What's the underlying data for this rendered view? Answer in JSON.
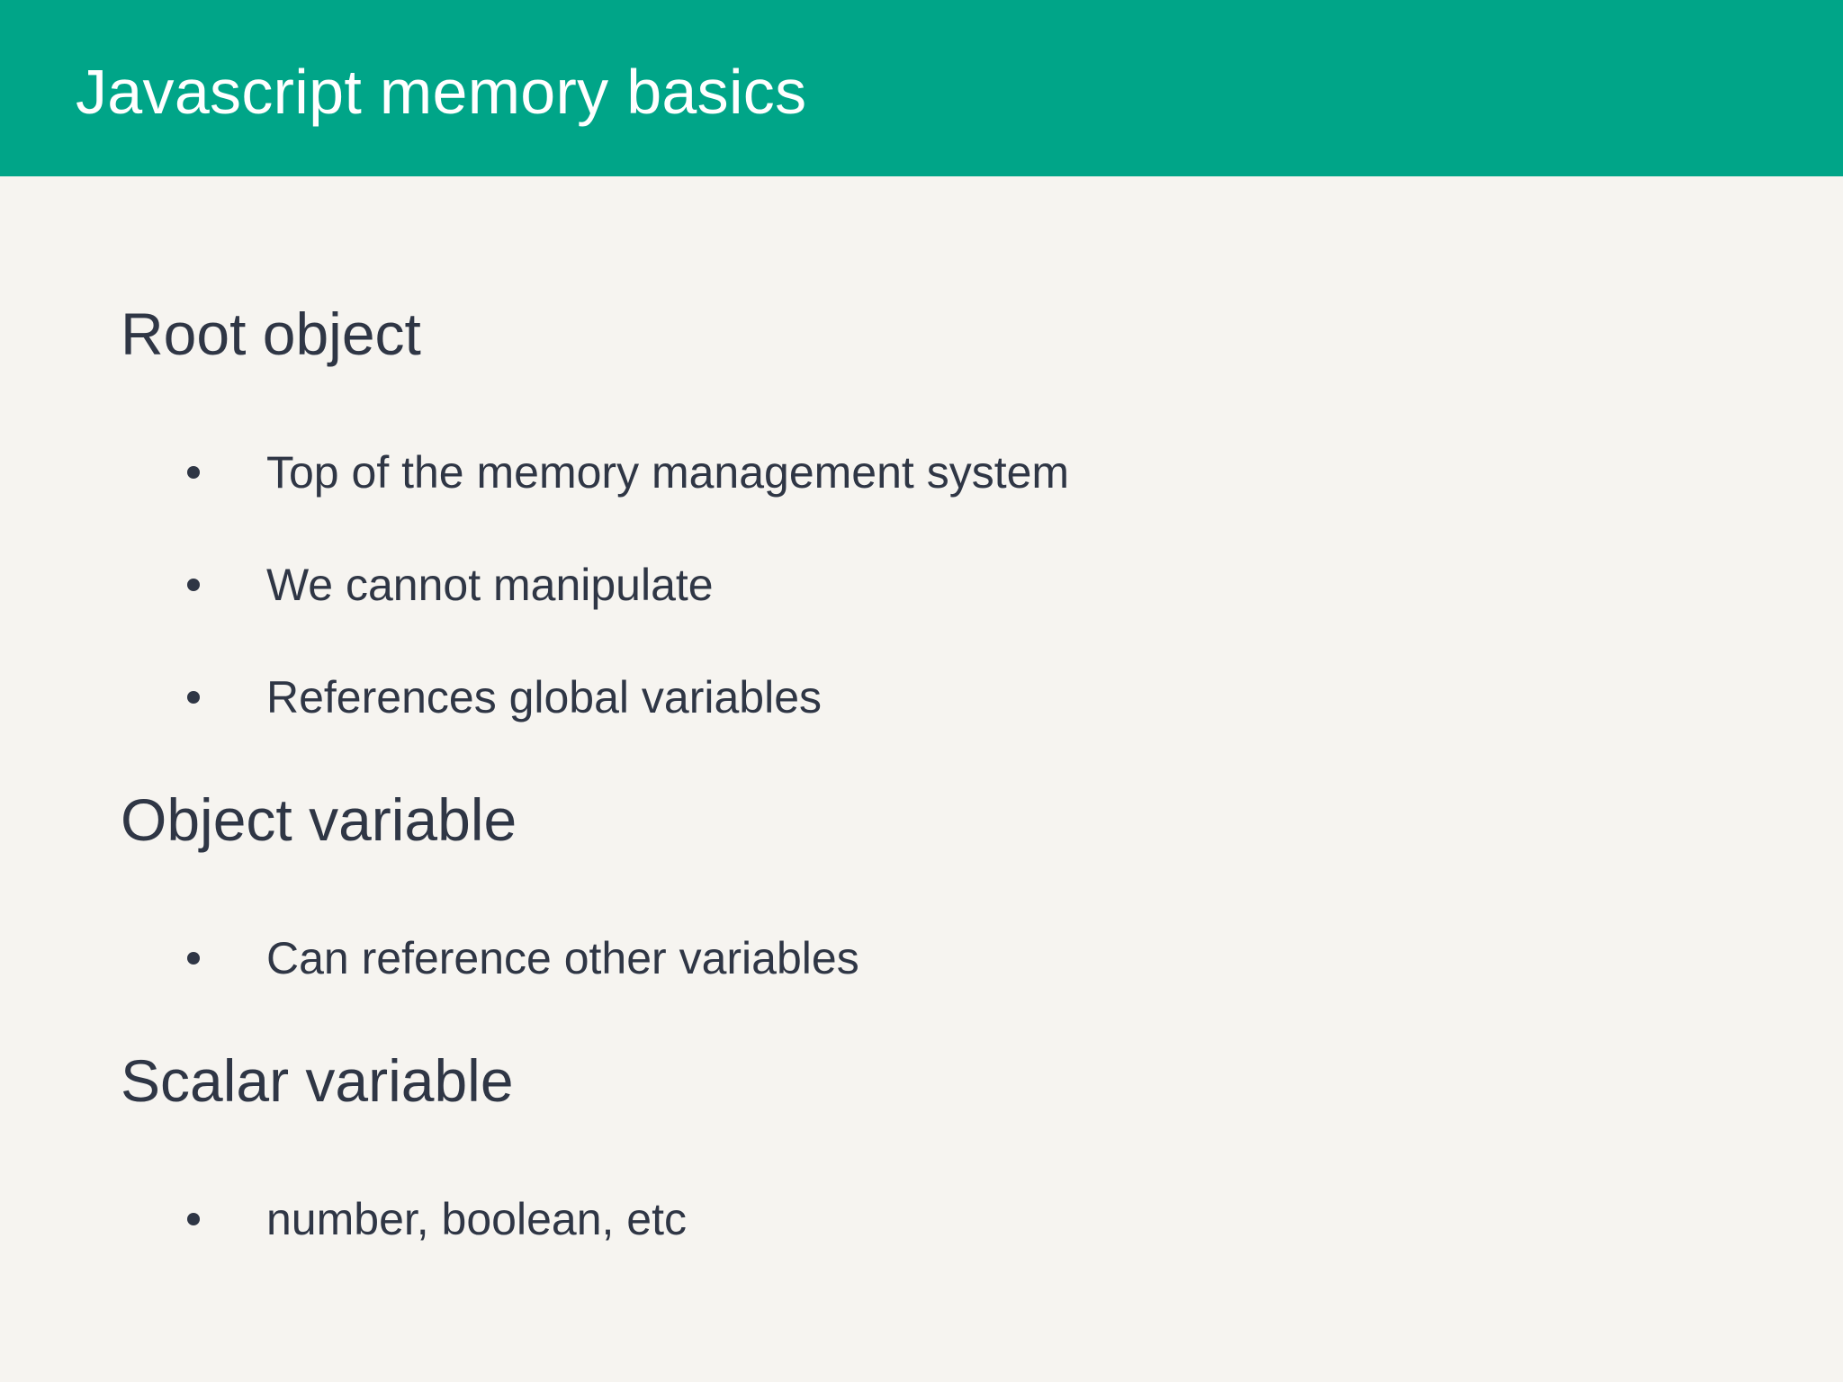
{
  "slide": {
    "title": "Javascript memory basics",
    "colors": {
      "header_background": "#00a588",
      "header_text": "#ffffff",
      "page_background": "#f6f4f0",
      "body_text": "#2f3645"
    },
    "sections": [
      {
        "heading": "Root object",
        "bullets": [
          "Top of the memory management system",
          "We cannot manipulate",
          "References global variables"
        ]
      },
      {
        "heading": "Object variable",
        "bullets": [
          "Can reference other variables"
        ]
      },
      {
        "heading": "Scalar variable",
        "bullets": [
          "number, boolean, etc"
        ]
      }
    ]
  }
}
